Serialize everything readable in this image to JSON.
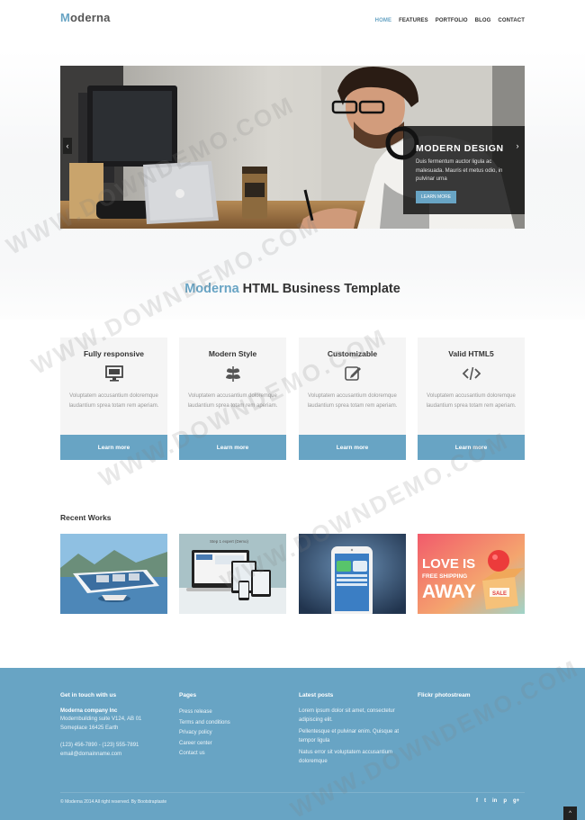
{
  "header": {
    "logo_first": "M",
    "logo_rest": "oderna",
    "nav": [
      "Home",
      "Features",
      "Portfolio",
      "Blog",
      "Contact"
    ],
    "active_nav": "Home"
  },
  "slider": {
    "title": "MODERN DESIGN",
    "text": "Duis fermentum auctor ligula ac malesuada. Mauris et metus odio, in pulvinar urna",
    "button": "Learn more",
    "prev_icon": "chevron-left-icon",
    "next_icon": "chevron-right-icon"
  },
  "intro": {
    "accent": "Moderna",
    "rest": " HTML Business Template"
  },
  "features": [
    {
      "title": "Fully responsive",
      "icon": "desktop-icon",
      "text": "Voluptatem accusantium doloremque laudantium sprea totam rem aperiam.",
      "button": "Learn more"
    },
    {
      "title": "Modern Style",
      "icon": "leaf-icon",
      "text": "Voluptatem accusantium doloremque laudantium sprea totam rem aperiam.",
      "button": "Learn more"
    },
    {
      "title": "Customizable",
      "icon": "edit-icon",
      "text": "Voluptatem accusantium doloremque laudantium sprea totam rem aperiam.",
      "button": "Learn more"
    },
    {
      "title": "Valid HTML5",
      "icon": "code-icon",
      "text": "Voluptatem accusantium doloremque laudantium sprea totam rem aperiam.",
      "button": "Learn more"
    }
  ],
  "recent": {
    "title": "Recent Works",
    "items": [
      {
        "name": "work-1"
      },
      {
        "name": "work-2",
        "text": "Step 1 expert (Demo)"
      },
      {
        "name": "work-3"
      },
      {
        "name": "work-4",
        "line1": "LOVE IS",
        "line2": "FREE SHIPPING",
        "line3": "AWAY",
        "tag": "SALE"
      }
    ]
  },
  "footer": {
    "contact": {
      "title": "Get in touch with us",
      "company": "Moderna company Inc",
      "address1": "Modernbuilding suite V124, AB 01",
      "address2": "Someplace 16425 Earth",
      "phone": "(123) 456-7890 - (123) 555-7891",
      "email": "email@domainname.com"
    },
    "pages": {
      "title": "Pages",
      "links": [
        "Press release",
        "Terms and conditions",
        "Privacy policy",
        "Career center",
        "Contact us"
      ]
    },
    "posts": {
      "title": "Latest posts",
      "items": [
        "Lorem ipsum dolor sit amet, consectetur adipiscing elit.",
        "Pellentesque et pulvinar enim. Quisque at tempor ligula",
        "Natus error sit voluptatem accusantium doloremque"
      ]
    },
    "flickr": {
      "title": "Flickr photostream"
    },
    "copyright": "© Moderna 2014 All right reserved. By Bootstraptaste",
    "social": [
      "f",
      "t",
      "in",
      "p",
      "g+"
    ],
    "to_top_icon": "chevron-up-icon"
  },
  "watermark": "WWW.DOWNDEMO.COM",
  "colors": {
    "accent": "#68a4c4",
    "footer": "#68a4c4",
    "caption_bg": "#141414"
  }
}
